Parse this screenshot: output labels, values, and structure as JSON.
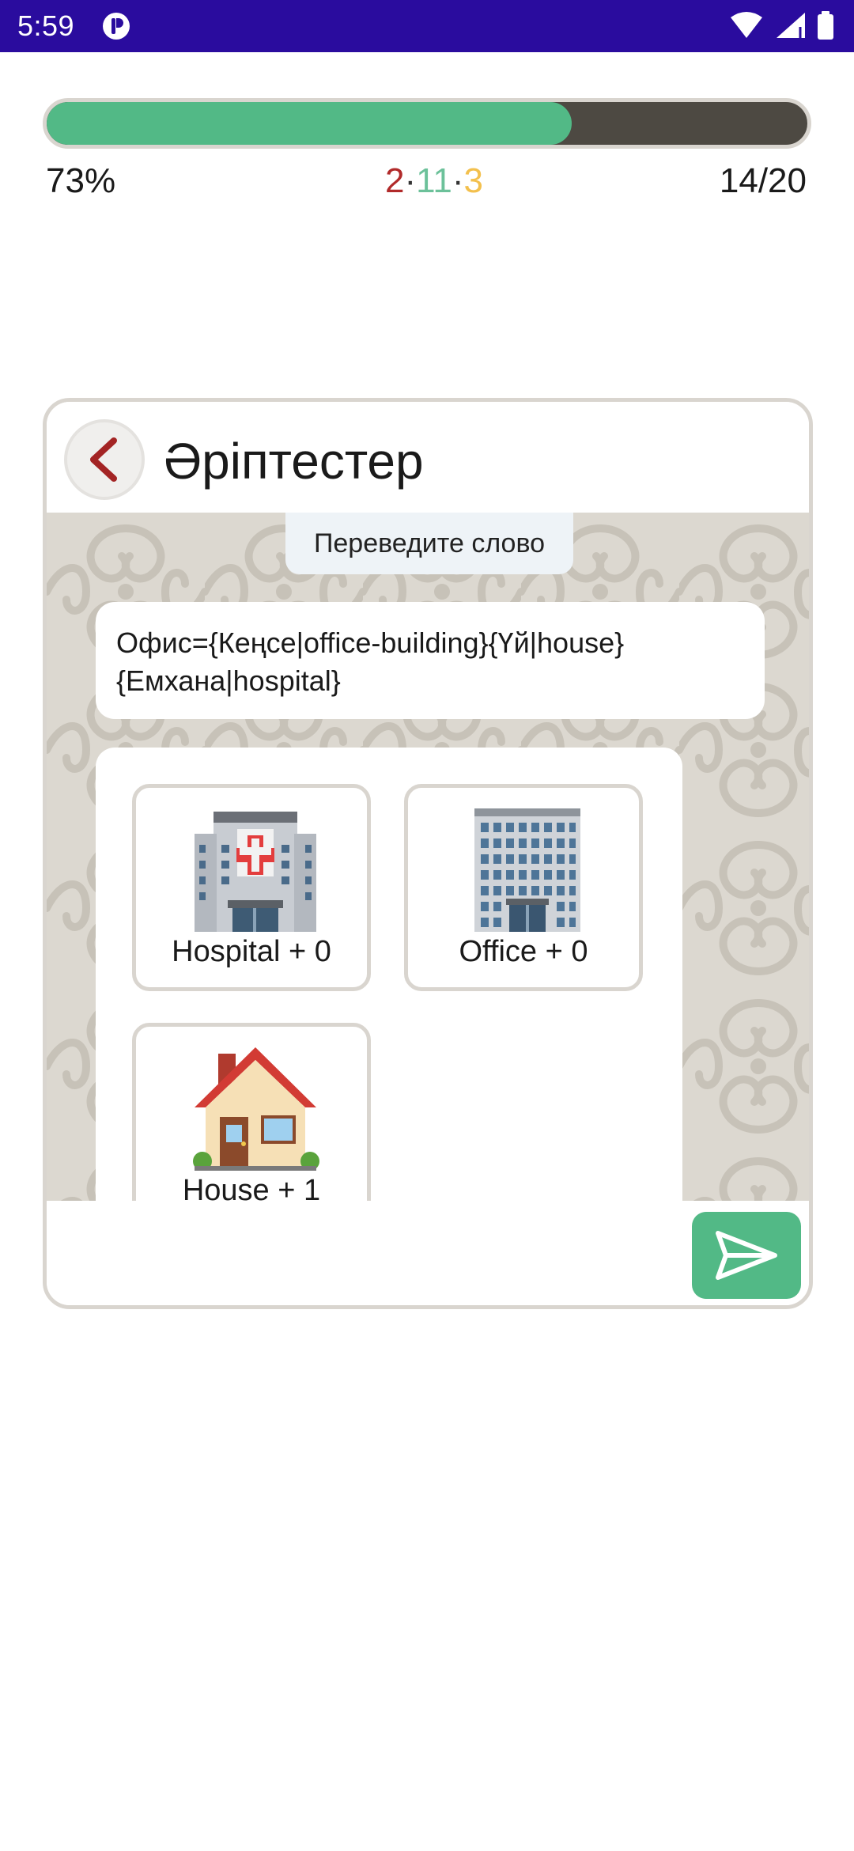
{
  "status_bar": {
    "time": "5:59",
    "icons": [
      "app-notification-icon",
      "wifi-icon",
      "cellular-signal-icon",
      "battery-icon"
    ]
  },
  "progress": {
    "percent_label": "73%",
    "fill_fraction": 0.69,
    "fill_color": "#52b986",
    "count_label": "14/20",
    "stats": {
      "wrong": "2",
      "correct": "11",
      "skipped": "3",
      "separator": "·"
    }
  },
  "card": {
    "title": "Әріптестер",
    "back_icon": "chevron-left-icon",
    "instruction": "Переведите слово",
    "question_line1": "Офис={Кеңсе|office-building}{Үй|house}",
    "question_line2": "{Емхана|hospital}",
    "options": [
      {
        "icon": "hospital-icon",
        "label": "Hospital + 0"
      },
      {
        "icon": "office-building-icon",
        "label": "Office + 0"
      },
      {
        "icon": "house-icon",
        "label": "House + 1"
      }
    ],
    "send_icon": "send-icon"
  },
  "colors": {
    "status_bar": "#2a0c9e",
    "accent_green": "#52b986",
    "wrong_red": "#b12a2a",
    "correct_green": "#6cc19a",
    "skipped_yellow": "#f3c04d"
  }
}
